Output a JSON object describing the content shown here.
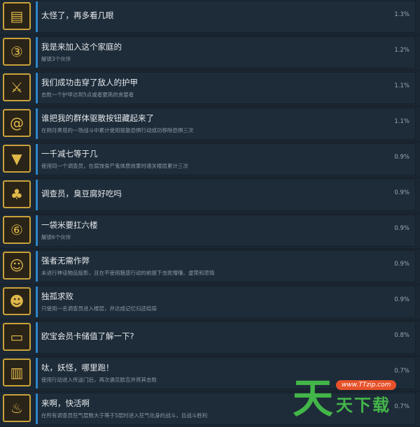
{
  "achievements": [
    {
      "icon": "book-icon",
      "title": "太怪了，再多看几眼",
      "desc": "",
      "pct": "1.3%"
    },
    {
      "icon": "crest-3-icon",
      "title": "我是来加入这个家庭的",
      "desc": "解锁3个伙伴",
      "pct": "1.2%"
    },
    {
      "icon": "armor-break-icon",
      "title": "我们成功击穿了敌人的护甲",
      "desc": "击败一个护甲达到5点或者更高的贪婪者",
      "pct": "1.1%"
    },
    {
      "icon": "spiral-icon",
      "title": "谁把我的群体驱散按钮藏起来了",
      "desc": "在朔月黑塔的一场战斗中累计使用驱散恐惧行动成功移除恐惧三次",
      "pct": "1.1%"
    },
    {
      "icon": "fanged-mouth-icon",
      "title": "一千减七等于几",
      "desc": "使用同一个调查员，在腐蚀食尸鬼体质效果时通关楼层累计三次",
      "pct": "0.9%"
    },
    {
      "icon": "creature-icon",
      "title": "调查员，臭豆腐好吃吗",
      "desc": "",
      "pct": "0.9%"
    },
    {
      "icon": "crest-6-icon",
      "title": "一袋米要扛六楼",
      "desc": "解锁6个伙伴",
      "pct": "0.9%"
    },
    {
      "icon": "warrior-icon",
      "title": "强者无需作弊",
      "desc": "未进行神话物品投影，且在不使用魅惑行动的前提下击败懵懂、虚荣和悲情",
      "pct": "0.9%"
    },
    {
      "icon": "lone-investigator-icon",
      "title": "独孤求败",
      "desc": "只使用一名调查员进入楼层，并达成记忆归还结局",
      "pct": "0.9%"
    },
    {
      "icon": "card-icon",
      "title": "欧宝会员卡储值了解一下?",
      "desc": "",
      "pct": "0.8%"
    },
    {
      "icon": "exit-door-icon",
      "title": "呔，妖怪，哪里跑！",
      "desc": "使用行动进入传送门后，再次遇见欧吉并将其击败",
      "pct": "0.7%"
    },
    {
      "icon": "frenzy-icon",
      "title": "来啊，快活啊",
      "desc": "在所有调查员狂气层数大于等于5层时进入狂气化身的战斗，且战斗胜利",
      "pct": "0.7%"
    }
  ],
  "watermark": {
    "big": "天",
    "badge": "www.TTzip.com",
    "sub": "天下载"
  }
}
